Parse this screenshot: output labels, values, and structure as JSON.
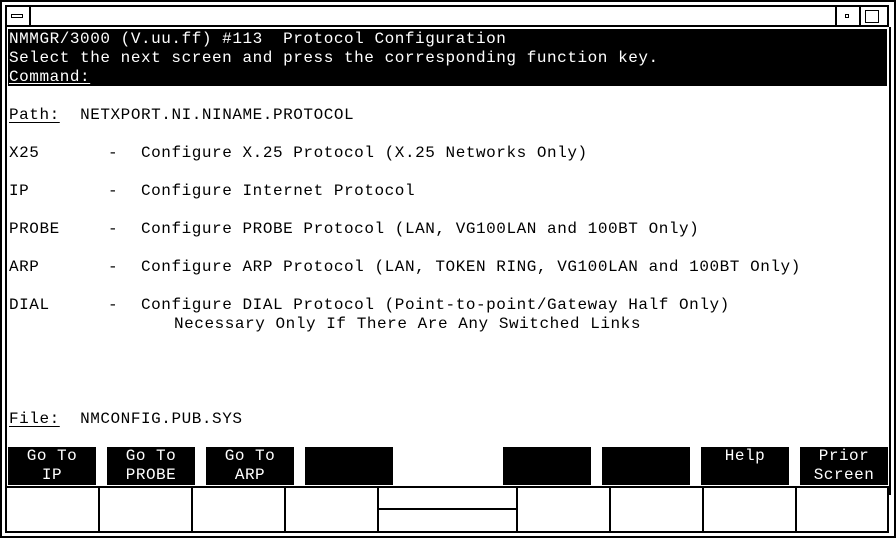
{
  "window": {
    "system_menu_icon": "system-menu-icon",
    "minimize_icon": "minimize-icon",
    "maximize_icon": "maximize-icon"
  },
  "header": {
    "title": "NMMGR/3000 (V.uu.ff) #113  Protocol Configuration",
    "instruction": "Select the next screen and press the corresponding function key.",
    "command_label": "Command:",
    "command_value": ""
  },
  "path": {
    "label": "Path:",
    "value": "NETXPORT.NI.NINAME.PROTOCOL"
  },
  "menu": [
    {
      "key": "X25",
      "dash": "-",
      "description": "Configure X.25 Protocol (X.25 Networks Only)",
      "note": ""
    },
    {
      "key": "IP",
      "dash": "-",
      "description": "Configure Internet Protocol",
      "note": ""
    },
    {
      "key": "PROBE",
      "dash": "-",
      "description": "Configure PROBE Protocol (LAN, VG100LAN and 100BT Only)",
      "note": ""
    },
    {
      "key": "ARP",
      "dash": "-",
      "description": "Configure ARP Protocol (LAN, TOKEN RING, VG100LAN and 100BT Only)",
      "note": ""
    },
    {
      "key": "DIAL",
      "dash": "-",
      "description": "Configure DIAL Protocol (Point-to-point/Gateway Half Only)",
      "note": "Necessary Only If There Are Any Switched Links"
    }
  ],
  "file": {
    "label": "File:",
    "value": "NMCONFIG.PUB.SYS"
  },
  "function_keys": [
    {
      "line1": "Go To",
      "line2": "IP"
    },
    {
      "line1": "Go To",
      "line2": "PROBE"
    },
    {
      "line1": "Go To",
      "line2": "ARP"
    },
    {
      "line1": "",
      "line2": ""
    },
    {
      "line1": "",
      "line2": ""
    },
    {
      "line1": "",
      "line2": ""
    },
    {
      "line1": "Help",
      "line2": ""
    },
    {
      "line1": "Prior",
      "line2": "Screen"
    }
  ]
}
